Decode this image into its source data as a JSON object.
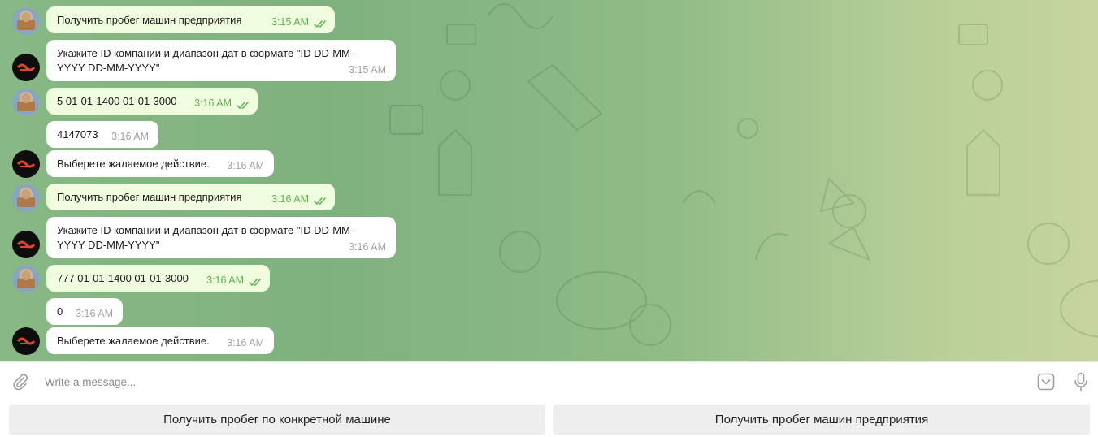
{
  "messages": [
    {
      "side": "out",
      "avatar": "user",
      "text": "Получить пробег машин предприятия",
      "time": "3:15 AM",
      "read": true
    },
    {
      "side": "in",
      "avatar": "bot",
      "text": "Укажите ID компании и диапазон дат в формате \"ID DD-MM-YYYY DD-MM-YYYY\"",
      "time": "3:15 AM"
    },
    {
      "side": "out",
      "avatar": "user",
      "text": "5 01-01-1400 01-01-3000",
      "time": "3:16 AM",
      "read": true
    },
    {
      "side": "in",
      "avatar": "none",
      "text": "4147073",
      "time": "3:16 AM"
    },
    {
      "side": "in",
      "avatar": "bot",
      "text": "Выберете жалаемое действие.",
      "time": "3:16 AM"
    },
    {
      "side": "out",
      "avatar": "user",
      "text": "Получить пробег машин предприятия",
      "time": "3:16 AM",
      "read": true
    },
    {
      "side": "in",
      "avatar": "bot",
      "text": "Укажите ID компании и диапазон дат в формате \"ID DD-MM-YYYY DD-MM-YYYY\"",
      "time": "3:16 AM"
    },
    {
      "side": "out",
      "avatar": "user",
      "text": "777 01-01-1400 01-01-3000",
      "time": "3:16 AM",
      "read": true
    },
    {
      "side": "in",
      "avatar": "none",
      "text": "0",
      "time": "3:16 AM"
    },
    {
      "side": "in",
      "avatar": "bot",
      "text": "Выберете жалаемое действие.",
      "time": "3:16 AM"
    }
  ],
  "composer": {
    "placeholder": "Write a message...",
    "icons": [
      "paperclip-icon",
      "bot-keyboard-icon",
      "microphone-icon"
    ]
  },
  "keyboard": {
    "buttons": [
      "Получить пробег по конкретной машине",
      "Получить пробег машин предприятия"
    ]
  },
  "colors": {
    "outgoing": "#effdde",
    "incoming": "#ffffff",
    "time_read": "#5fb150"
  }
}
